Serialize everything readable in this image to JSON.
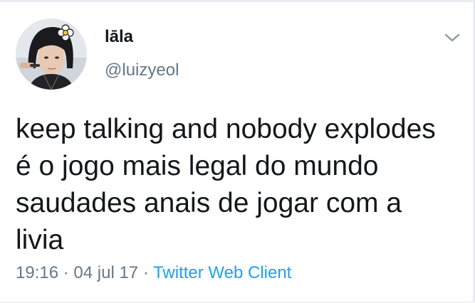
{
  "tweet": {
    "display_name": "lāla",
    "handle": "@luizyeol",
    "text_lines": [
      "keep talking and nobody explodes",
      "é o jogo mais legal do mundo",
      "saudades anais de jogar com a",
      "livia"
    ],
    "time": "19:16",
    "separator": "·",
    "date": "04 jul 17",
    "source": "Twitter Web Client"
  },
  "icons": {
    "avatar": "user-avatar-photo",
    "menu": "chevron-down-icon"
  },
  "colors": {
    "text": "#14171a",
    "secondary": "#657786",
    "link": "#1da1f2"
  }
}
